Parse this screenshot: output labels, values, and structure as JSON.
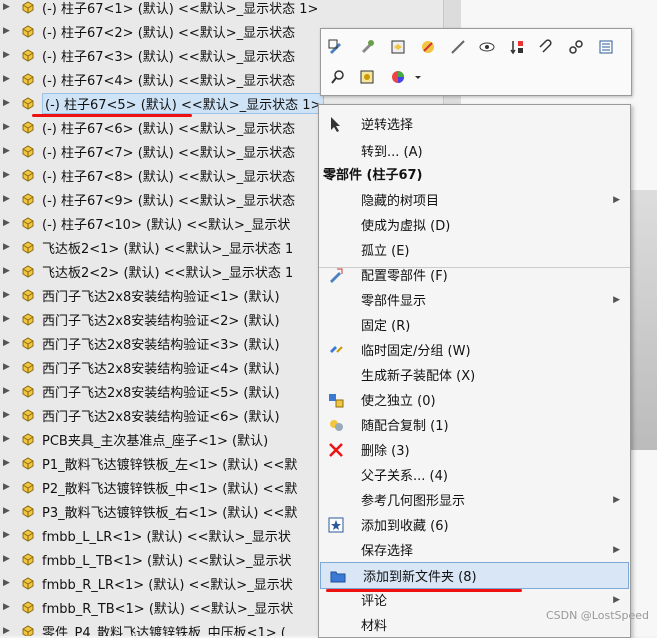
{
  "tree": {
    "items": [
      {
        "label": "(-) 柱子67<1> (默认) <<默认>_显示状态 1>"
      },
      {
        "label": "(-) 柱子67<2> (默认) <<默认>_显示状态"
      },
      {
        "label": "(-) 柱子67<3> (默认) <<默认>_显示状态"
      },
      {
        "label": "(-) 柱子67<4> (默认) <<默认>_显示状态"
      },
      {
        "label": "(-) 柱子67<5> (默认) <<默认>_显示状态 1>",
        "selected": true
      },
      {
        "label": "(-) 柱子67<6> (默认) <<默认>_显示状态"
      },
      {
        "label": "(-) 柱子67<7> (默认) <<默认>_显示状态"
      },
      {
        "label": "(-) 柱子67<8> (默认) <<默认>_显示状态"
      },
      {
        "label": "(-) 柱子67<9> (默认) <<默认>_显示状态"
      },
      {
        "label": "(-) 柱子67<10> (默认) <<默认>_显示状"
      },
      {
        "label": "飞达板2<1> (默认) <<默认>_显示状态 1"
      },
      {
        "label": "飞达板2<2> (默认) <<默认>_显示状态 1"
      },
      {
        "label": "西门子飞达2x8安装结构验证<1> (默认)"
      },
      {
        "label": "西门子飞达2x8安装结构验证<2> (默认)"
      },
      {
        "label": "西门子飞达2x8安装结构验证<3> (默认)"
      },
      {
        "label": "西门子飞达2x8安装结构验证<4> (默认)"
      },
      {
        "label": "西门子飞达2x8安装结构验证<5> (默认)"
      },
      {
        "label": "西门子飞达2x8安装结构验证<6> (默认)"
      },
      {
        "label": "PCB夹具_主次基准点_座子<1> (默认)"
      },
      {
        "label": "P1_散料飞达镀锌铁板_左<1> (默认) <<默"
      },
      {
        "label": "P2_散料飞达镀锌铁板_中<1> (默认) <<默"
      },
      {
        "label": "P3_散料飞达镀锌铁板_右<1> (默认) <<默"
      },
      {
        "label": "fmbb_L_LR<1> (默认) <<默认>_显示状"
      },
      {
        "label": "fmbb_L_TB<1> (默认) <<默认>_显示状"
      },
      {
        "label": "fmbb_R_LR<1> (默认) <<默认>_显示状"
      },
      {
        "label": "fmbb_R_TB<1> (默认) <<默认>_显示状"
      },
      {
        "label": "零件_P4_散料飞达镀锌铁板_中压板<1> ("
      }
    ]
  },
  "toolbar": {
    "icons": [
      "edit-part-icon",
      "tool-icon",
      "open-part-icon",
      "appearance-icon",
      "hide-line-icon",
      "eye-icon",
      "sort-icon",
      "paperclip-icon",
      "link-icon",
      "properties-icon",
      "zoom-icon",
      "view-icon",
      "color-wheel-icon",
      "dropdown-arrow-icon"
    ]
  },
  "menu": {
    "items": [
      {
        "label": "逆转选择",
        "icon": "cursor-icon"
      },
      {
        "label": "转到... (A)"
      },
      {
        "label": "零部件 (柱子67)",
        "header": true
      },
      {
        "label": "隐藏的树项目",
        "submenu": true
      },
      {
        "label": "使成为虚拟 (D)"
      },
      {
        "label": "孤立 (E)"
      },
      {
        "label": "配置零部件 (F)",
        "icon": "pencil-config-icon"
      },
      {
        "label": "零部件显示",
        "submenu": true
      },
      {
        "label": "固定 (R)"
      },
      {
        "label": "临时固定/分组 (W)",
        "icon": "temp-fix-icon"
      },
      {
        "label": "生成新子装配体 (X)"
      },
      {
        "label": "使之独立 (0)",
        "icon": "make-independent-icon"
      },
      {
        "label": "随配合复制 (1)",
        "icon": "copy-mates-icon"
      },
      {
        "label": "删除 (3)",
        "icon": "delete-x-icon"
      },
      {
        "label": "父子关系... (4)"
      },
      {
        "label": "参考几何图形显示",
        "submenu": true
      },
      {
        "label": "添加到收藏 (6)",
        "icon": "favorite-icon"
      },
      {
        "label": "保存选择",
        "submenu": true
      },
      {
        "label": "添加到新文件夹 (8)",
        "icon": "folder-icon",
        "highlighted": true
      },
      {
        "label": "评论",
        "submenu": true
      },
      {
        "label": "材料"
      }
    ]
  },
  "watermark": "CSDN @LostSpeed",
  "colors": {
    "selection": "#cfe3f7",
    "annotation_red": "#ee1111",
    "menu_highlight": "#d8e6f5"
  }
}
